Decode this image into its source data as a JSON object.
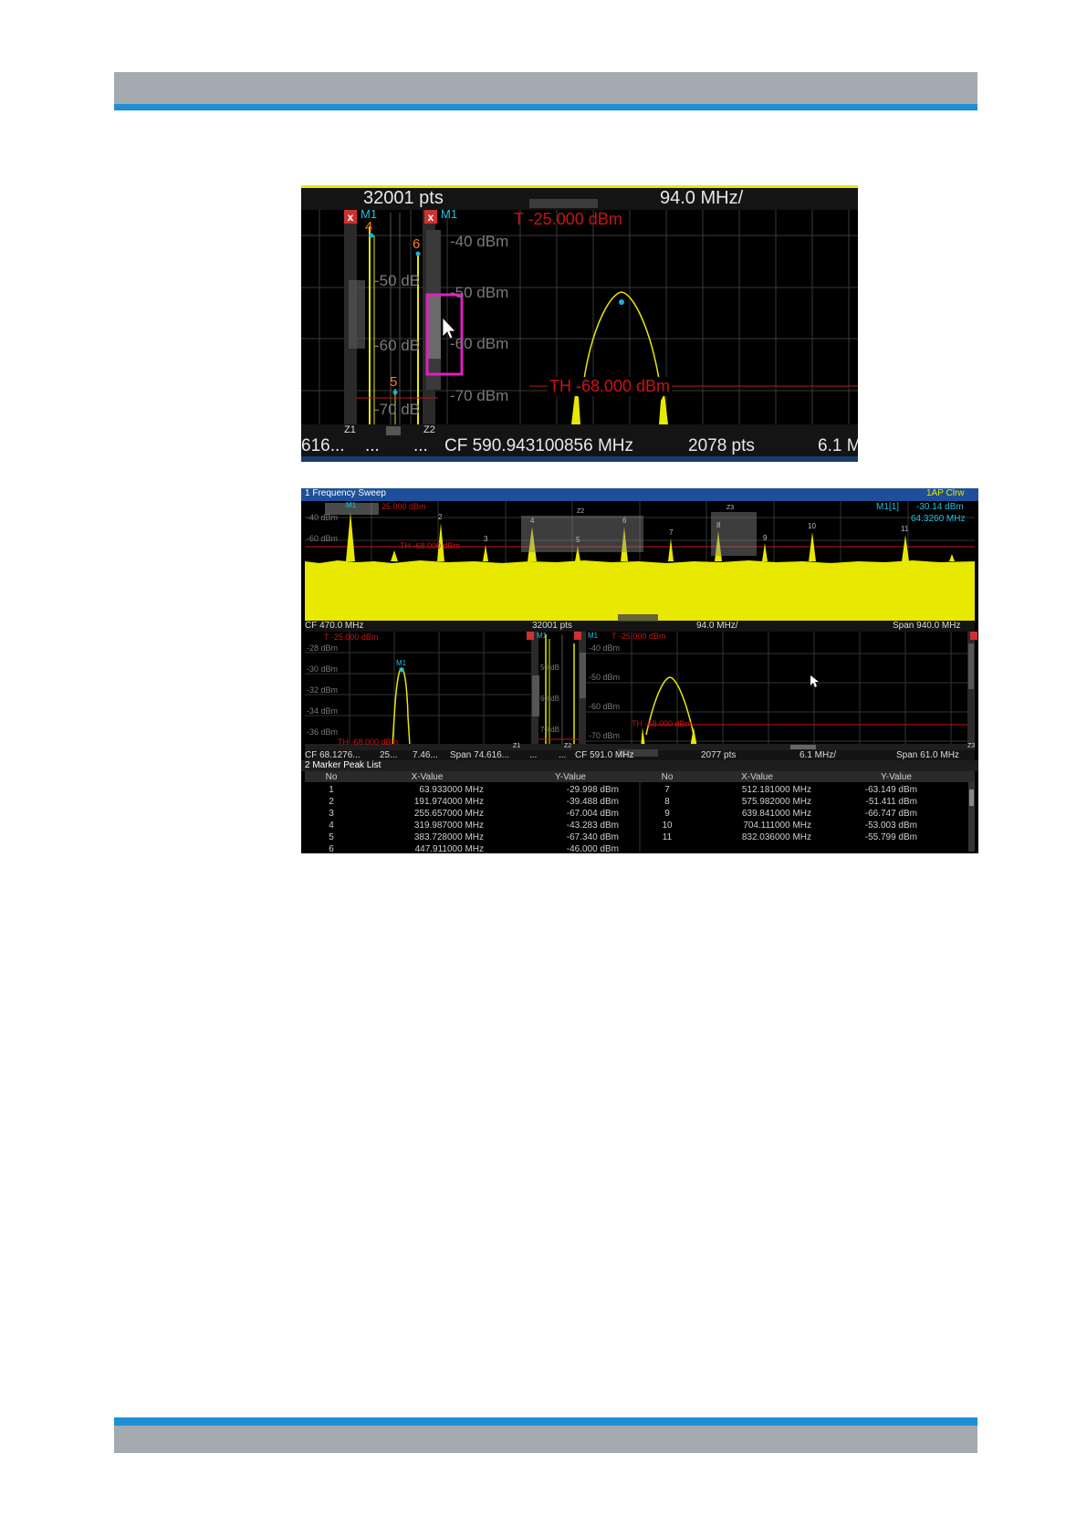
{
  "zoom_figure": {
    "top_bar": {
      "points": "32001 pts",
      "per_div": "94.0 MHz/"
    },
    "left_window": {
      "marker": "M1",
      "markers": [
        "4",
        "6",
        "5"
      ],
      "levels": [
        "-50 dB",
        "-60 dB",
        "-70 dB"
      ],
      "zoom_label": "Z1"
    },
    "right_window": {
      "marker": "M1",
      "zoom_label": "Z2",
      "threshold_top": "T -25.000 dBm",
      "threshold": "TH -68.000 dBm",
      "levels": [
        "-40 dBm",
        "-50 dBm",
        "-60 dBm",
        "-70 dBm"
      ]
    },
    "bottom_bar": {
      "left_trunc": "616...",
      "dots1": "...",
      "dots2": "...",
      "center": "CF 590.943100856 MHz",
      "points": "2078 pts",
      "per_div": "6.1 M"
    }
  },
  "screen": {
    "sweep_title": "1 Frequency Sweep",
    "trace_info": "1AP Clrw",
    "marker_readout": {
      "name": "M1[1]",
      "level": "-30.14 dBm",
      "freq": "64.3260 MHz"
    },
    "overview": {
      "threshold_top": "25.000 dBm",
      "threshold": "TH -68.000 dBm",
      "levels": [
        "-40 dBm",
        "-60 dBm"
      ],
      "marker_labels": [
        "M1",
        "2",
        "3",
        "4",
        "5",
        "6",
        "7",
        "8",
        "9",
        "10",
        "11"
      ],
      "zoom_labels": [
        "Z2",
        "Z3"
      ],
      "footer": {
        "cf": "CF 470.0 MHz",
        "pts": "32001 pts",
        "div": "94.0 MHz/",
        "span": "Span 940.0 MHz"
      }
    },
    "zoom1": {
      "threshold_top": "T -25.000 dBm",
      "threshold": "TH -68.000 dBm",
      "marker": "M1",
      "levels": [
        "-28 dBm",
        "-30 dBm",
        "-32 dBm",
        "-34 dBm",
        "-36 dBm"
      ],
      "footer": {
        "cf": "CF 68.1276...",
        "f2": "25...",
        "f3": "7.46...",
        "span": "Span 74.616..."
      }
    },
    "zoom_mid": {
      "marker": "M1",
      "levels": [
        "50 dB",
        "60 dB",
        "70 dB"
      ],
      "zoom_labels": [
        "Z1",
        "Z2"
      ],
      "footer_dots": "..."
    },
    "zoom2": {
      "marker": "M1",
      "threshold_top": "T -25.000 dBm",
      "threshold": "TH -68.000 dBm",
      "levels": [
        "-40 dBm",
        "-50 dBm",
        "-60 dBm",
        "-70 dBm"
      ],
      "zoom_label": "Z3",
      "footer": {
        "cf": "CF 591.0 MHz",
        "pts": "2077 pts",
        "div": "6.1 MHz/",
        "span": "Span 61.0 MHz"
      }
    },
    "peak_list": {
      "title": "2 Marker Peak List",
      "headers": [
        "No",
        "X-Value",
        "Y-Value",
        "No",
        "X-Value",
        "Y-Value"
      ],
      "left": [
        [
          "1",
          "63.933000 MHz",
          "-29.998 dBm"
        ],
        [
          "2",
          "191.974000 MHz",
          "-39.488 dBm"
        ],
        [
          "3",
          "255.657000 MHz",
          "-67.004 dBm"
        ],
        [
          "4",
          "319.987000 MHz",
          "-43.283 dBm"
        ],
        [
          "5",
          "383.728000 MHz",
          "-67.340 dBm"
        ],
        [
          "6",
          "447.911000 MHz",
          "-46.000 dBm"
        ]
      ],
      "right": [
        [
          "7",
          "512.181000 MHz",
          "-63.149 dBm"
        ],
        [
          "8",
          "575.982000 MHz",
          "-51.411 dBm"
        ],
        [
          "9",
          "639.841000 MHz",
          "-66.747 dBm"
        ],
        [
          "10",
          "704.111000 MHz",
          "-53.003 dBm"
        ],
        [
          "11",
          "832.036000 MHz",
          "-55.799 dBm"
        ]
      ]
    }
  }
}
